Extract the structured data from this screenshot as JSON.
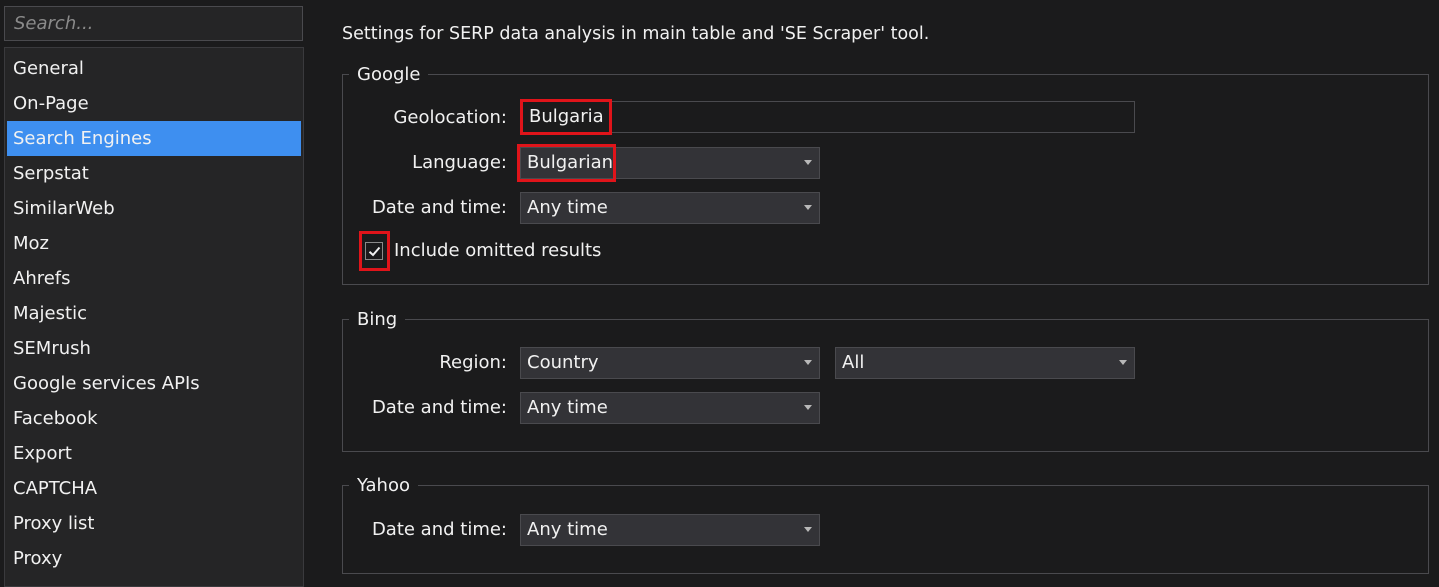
{
  "sidebar": {
    "search_placeholder": "Search...",
    "items": [
      {
        "label": "General"
      },
      {
        "label": "On-Page"
      },
      {
        "label": "Search Engines",
        "active": true
      },
      {
        "label": "Serpstat"
      },
      {
        "label": "SimilarWeb"
      },
      {
        "label": "Moz"
      },
      {
        "label": "Ahrefs"
      },
      {
        "label": "Majestic"
      },
      {
        "label": "SEMrush"
      },
      {
        "label": "Google services APIs"
      },
      {
        "label": "Facebook"
      },
      {
        "label": "Export"
      },
      {
        "label": "CAPTCHA"
      },
      {
        "label": "Proxy list"
      },
      {
        "label": "Proxy"
      }
    ]
  },
  "main": {
    "description": "Settings for SERP data analysis in main table and 'SE Scraper' tool.",
    "google": {
      "legend": "Google",
      "geolocation_label": "Geolocation:",
      "geolocation_value": "Bulgaria",
      "language_label": "Language:",
      "language_value": "Bulgarian",
      "datetime_label": "Date and time:",
      "datetime_value": "Any time",
      "omitted_label": "Include omitted results",
      "omitted_checked": true
    },
    "bing": {
      "legend": "Bing",
      "region_label": "Region:",
      "region_value": "Country",
      "region_scope_value": "All",
      "datetime_label": "Date and time:",
      "datetime_value": "Any time"
    },
    "yahoo": {
      "legend": "Yahoo",
      "datetime_label": "Date and time:",
      "datetime_value": "Any time"
    }
  },
  "colors": {
    "background": "#1b1b1c",
    "accent": "#3e8ff0",
    "highlight": "#e0141a"
  }
}
